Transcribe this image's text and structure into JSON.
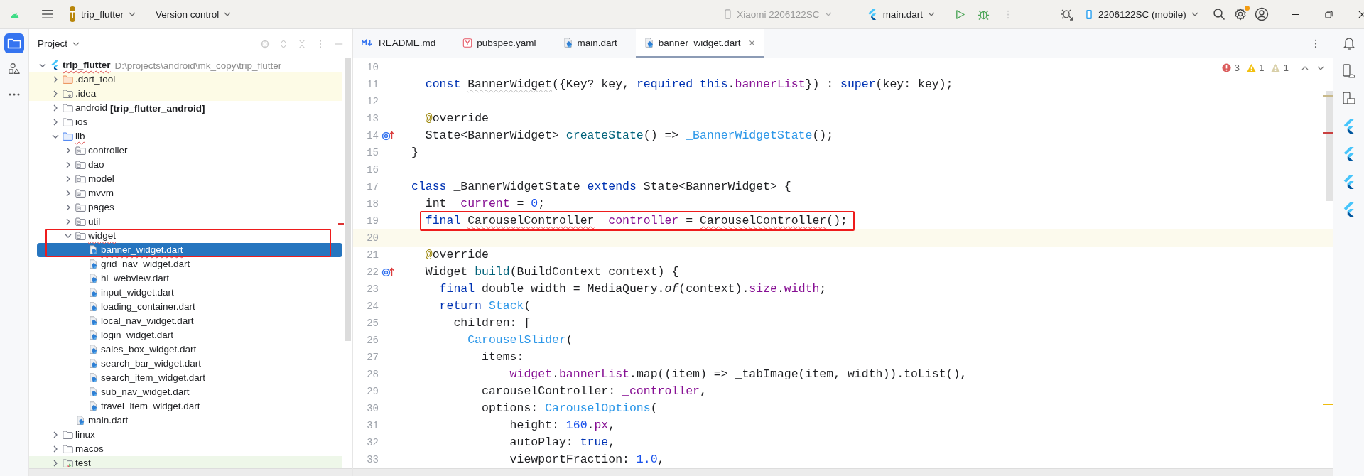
{
  "title_bar": {
    "project_badge": "T",
    "project": "trip_flutter",
    "vcs": "Version control",
    "device_inactive": "Xiaomi 2206122SC",
    "run_config": "main.dart",
    "device": "2206122SC (mobile)",
    "settings_update": true
  },
  "left_toolbar": [
    {
      "kind": "project",
      "selected": true
    },
    {
      "kind": "structure",
      "selected": false
    },
    {
      "kind": "more",
      "selected": false
    }
  ],
  "project_panel": {
    "title": "Project",
    "tree": [
      {
        "name": "trip_flutter",
        "kind": "project",
        "path": "D:\\projects\\android\\mk_copy\\trip_flutter",
        "expanded": true,
        "selected": false,
        "spell_warning": true,
        "children": [
          {
            "name": ".dart_tool",
            "kind": "folder-excluded",
            "expanded": false,
            "selected": false,
            "spell_warning": false
          },
          {
            "name": ".idea",
            "kind": "folder-config",
            "expanded": false,
            "selected": false,
            "spell_warning": false
          },
          {
            "name": "android",
            "note": "[trip_flutter_android]",
            "kind": "folder",
            "expanded": false,
            "selected": false,
            "spell_warning": false
          },
          {
            "name": "ios",
            "kind": "folder",
            "expanded": false,
            "selected": false,
            "spell_warning": false
          },
          {
            "name": "lib",
            "kind": "folder-source",
            "expanded": true,
            "selected": false,
            "spell_warning": true,
            "children": [
              {
                "name": "controller",
                "kind": "package",
                "expanded": false,
                "selected": false,
                "spell_warning": false
              },
              {
                "name": "dao",
                "kind": "package",
                "expanded": false,
                "selected": false,
                "spell_warning": false
              },
              {
                "name": "model",
                "kind": "package",
                "expanded": false,
                "selected": false,
                "spell_warning": false
              },
              {
                "name": "mvvm",
                "kind": "package",
                "expanded": false,
                "selected": false,
                "spell_warning": false
              },
              {
                "name": "pages",
                "kind": "package",
                "expanded": false,
                "selected": false,
                "spell_warning": false
              },
              {
                "name": "util",
                "kind": "package",
                "expanded": false,
                "selected": false,
                "spell_warning": false
              },
              {
                "name": "widget",
                "kind": "package",
                "expanded": true,
                "selected": false,
                "spell_warning": true,
                "annotated": true,
                "children": [
                  {
                    "name": "banner_widget.dart",
                    "kind": "dart-file",
                    "selected": true,
                    "spell_warning": true,
                    "annotated": true
                  },
                  {
                    "name": "grid_nav_widget.dart",
                    "kind": "dart-file",
                    "selected": false,
                    "spell_warning": false
                  },
                  {
                    "name": "hi_webview.dart",
                    "kind": "dart-file",
                    "selected": false,
                    "spell_warning": false
                  },
                  {
                    "name": "input_widget.dart",
                    "kind": "dart-file",
                    "selected": false,
                    "spell_warning": false
                  },
                  {
                    "name": "loading_container.dart",
                    "kind": "dart-file",
                    "selected": false,
                    "spell_warning": false
                  },
                  {
                    "name": "local_nav_widget.dart",
                    "kind": "dart-file",
                    "selected": false,
                    "spell_warning": false
                  },
                  {
                    "name": "login_widget.dart",
                    "kind": "dart-file",
                    "selected": false,
                    "spell_warning": false
                  },
                  {
                    "name": "sales_box_widget.dart",
                    "kind": "dart-file",
                    "selected": false,
                    "spell_warning": false
                  },
                  {
                    "name": "search_bar_widget.dart",
                    "kind": "dart-file",
                    "selected": false,
                    "spell_warning": false
                  },
                  {
                    "name": "search_item_widget.dart",
                    "kind": "dart-file",
                    "selected": false,
                    "spell_warning": false
                  },
                  {
                    "name": "sub_nav_widget.dart",
                    "kind": "dart-file",
                    "selected": false,
                    "spell_warning": false
                  },
                  {
                    "name": "travel_item_widget.dart",
                    "kind": "dart-file",
                    "selected": false,
                    "spell_warning": false
                  }
                ]
              },
              {
                "name": "main.dart",
                "kind": "dart-file",
                "selected": false,
                "spell_warning": false
              }
            ]
          },
          {
            "name": "linux",
            "kind": "folder",
            "expanded": false,
            "selected": false,
            "spell_warning": false
          },
          {
            "name": "macos",
            "kind": "folder",
            "expanded": false,
            "selected": false,
            "spell_warning": false
          },
          {
            "name": "test",
            "kind": "folder-test",
            "expanded": false,
            "selected": false,
            "spell_warning": false
          }
        ]
      }
    ]
  },
  "tabs": [
    {
      "label": "README.md",
      "kind": "markdown",
      "selected": false
    },
    {
      "label": "pubspec.yaml",
      "kind": "yaml",
      "selected": false
    },
    {
      "label": "main.dart",
      "kind": "dart",
      "selected": false
    },
    {
      "label": "banner_widget.dart",
      "kind": "dart",
      "selected": true
    }
  ],
  "inspections": {
    "errors": "3",
    "warnings": "1",
    "weak_warnings": "1"
  },
  "code": {
    "lines": [
      {
        "number": "10",
        "current": false,
        "override": false
      },
      {
        "number": "11",
        "current": false,
        "override": false,
        "tokens": [
          {
            "text": "  const ",
            "kind": "kw"
          },
          {
            "text": "BannerWidget",
            "kind": "weak"
          },
          {
            "text": "({Key? key, ",
            "kind": "plain"
          },
          {
            "text": "required this",
            "kind": "kw"
          },
          {
            "text": ".",
            "kind": "plain"
          },
          {
            "text": "bannerList",
            "kind": "field"
          },
          {
            "text": "}) : ",
            "kind": "plain"
          },
          {
            "text": "super",
            "kind": "kw"
          },
          {
            "text": "(key: key);",
            "kind": "plain"
          }
        ]
      },
      {
        "number": "12",
        "current": false,
        "override": false
      },
      {
        "number": "13",
        "current": false,
        "override": false,
        "tokens": [
          {
            "text": "  @",
            "kind": "ann"
          },
          {
            "text": "override",
            "kind": "plain"
          }
        ]
      },
      {
        "number": "14",
        "current": false,
        "override": true,
        "tokens": [
          {
            "text": "  State<BannerWidget> ",
            "kind": "plain"
          },
          {
            "text": "createState",
            "kind": "fn"
          },
          {
            "text": "() => ",
            "kind": "plain"
          },
          {
            "text": "_BannerWidgetState",
            "kind": "cls"
          },
          {
            "text": "();",
            "kind": "plain"
          }
        ]
      },
      {
        "number": "15",
        "current": false,
        "override": false,
        "tokens": [
          {
            "text": "}",
            "kind": "plain"
          }
        ]
      },
      {
        "number": "16",
        "current": false,
        "override": false
      },
      {
        "number": "17",
        "current": false,
        "override": false,
        "tokens": [
          {
            "text": "class",
            "kind": "kw"
          },
          {
            "text": " _BannerWidgetState ",
            "kind": "plain"
          },
          {
            "text": "extends",
            "kind": "kw"
          },
          {
            "text": " State<BannerWidget> {",
            "kind": "plain"
          }
        ]
      },
      {
        "number": "18",
        "current": false,
        "override": false,
        "tokens": [
          {
            "text": "  int  ",
            "kind": "plain"
          },
          {
            "text": "current",
            "kind": "field"
          },
          {
            "text": " = ",
            "kind": "plain"
          },
          {
            "text": "0",
            "kind": "num"
          },
          {
            "text": ";",
            "kind": "plain"
          }
        ]
      },
      {
        "number": "19",
        "current": false,
        "override": false,
        "annotated": true,
        "tokens": [
          {
            "text": "  final ",
            "kind": "kw"
          },
          {
            "text": "CarouselController",
            "kind": "error"
          },
          {
            "text": " _controller",
            "kind": "field"
          },
          {
            "text": " = ",
            "kind": "plain"
          },
          {
            "text": "CarouselController",
            "kind": "error"
          },
          {
            "text": "();",
            "kind": "plain"
          }
        ]
      },
      {
        "number": "20",
        "current": true,
        "override": false
      },
      {
        "number": "21",
        "current": false,
        "override": false,
        "tokens": [
          {
            "text": "  @",
            "kind": "ann"
          },
          {
            "text": "override",
            "kind": "plain"
          }
        ]
      },
      {
        "number": "22",
        "current": false,
        "override": true,
        "tokens": [
          {
            "text": "  Widget ",
            "kind": "plain"
          },
          {
            "text": "build",
            "kind": "fn"
          },
          {
            "text": "(BuildContext context) {",
            "kind": "plain"
          }
        ]
      },
      {
        "number": "23",
        "current": false,
        "override": false,
        "tokens": [
          {
            "text": "    final",
            "kind": "kw"
          },
          {
            "text": " double width = MediaQuery.",
            "kind": "plain"
          },
          {
            "text": "of",
            "kind": "italic"
          },
          {
            "text": "(context).",
            "kind": "plain"
          },
          {
            "text": "size",
            "kind": "field"
          },
          {
            "text": ".",
            "kind": "plain"
          },
          {
            "text": "width",
            "kind": "field"
          },
          {
            "text": ";",
            "kind": "plain"
          }
        ]
      },
      {
        "number": "24",
        "current": false,
        "override": false,
        "tokens": [
          {
            "text": "    return ",
            "kind": "kw"
          },
          {
            "text": "Stack",
            "kind": "cls"
          },
          {
            "text": "(",
            "kind": "plain"
          }
        ]
      },
      {
        "number": "25",
        "current": false,
        "override": false,
        "tokens": [
          {
            "text": "      children: [",
            "kind": "plain"
          }
        ]
      },
      {
        "number": "26",
        "current": false,
        "override": false,
        "tokens": [
          {
            "text": "        CarouselSlider",
            "kind": "cls"
          },
          {
            "text": "(",
            "kind": "plain"
          }
        ]
      },
      {
        "number": "27",
        "current": false,
        "override": false,
        "tokens": [
          {
            "text": "          items:",
            "kind": "plain"
          }
        ]
      },
      {
        "number": "28",
        "current": false,
        "override": false,
        "tokens": [
          {
            "text": "              widget",
            "kind": "field"
          },
          {
            "text": ".",
            "kind": "plain"
          },
          {
            "text": "bannerList",
            "kind": "field"
          },
          {
            "text": ".map((item) => _tabImage(item, width)).toList(),",
            "kind": "plain"
          }
        ]
      },
      {
        "number": "29",
        "current": false,
        "override": false,
        "tokens": [
          {
            "text": "          carouselController: ",
            "kind": "plain"
          },
          {
            "text": "_controller",
            "kind": "field"
          },
          {
            "text": ",",
            "kind": "plain"
          }
        ]
      },
      {
        "number": "30",
        "current": false,
        "override": false,
        "tokens": [
          {
            "text": "          options: ",
            "kind": "plain"
          },
          {
            "text": "CarouselOptions",
            "kind": "cls"
          },
          {
            "text": "(",
            "kind": "plain"
          }
        ]
      },
      {
        "number": "31",
        "current": false,
        "override": false,
        "tokens": [
          {
            "text": "              height: ",
            "kind": "plain"
          },
          {
            "text": "160",
            "kind": "num"
          },
          {
            "text": ".",
            "kind": "plain"
          },
          {
            "text": "px",
            "kind": "field"
          },
          {
            "text": ",",
            "kind": "plain"
          }
        ]
      },
      {
        "number": "32",
        "current": false,
        "override": false,
        "tokens": [
          {
            "text": "              autoPlay: ",
            "kind": "plain"
          },
          {
            "text": "true",
            "kind": "kw"
          },
          {
            "text": ",",
            "kind": "plain"
          }
        ]
      },
      {
        "number": "33",
        "current": false,
        "override": false,
        "tokens": [
          {
            "text": "              viewportFraction: ",
            "kind": "plain"
          },
          {
            "text": "1.0",
            "kind": "num"
          },
          {
            "text": ",",
            "kind": "plain"
          }
        ]
      }
    ]
  },
  "right_toolbar": [
    {
      "kind": "notifications"
    },
    {
      "kind": "device-manager"
    },
    {
      "kind": "device-mirroring"
    },
    {
      "kind": "flutter"
    },
    {
      "kind": "flutter"
    },
    {
      "kind": "flutter"
    },
    {
      "kind": "flutter"
    }
  ]
}
